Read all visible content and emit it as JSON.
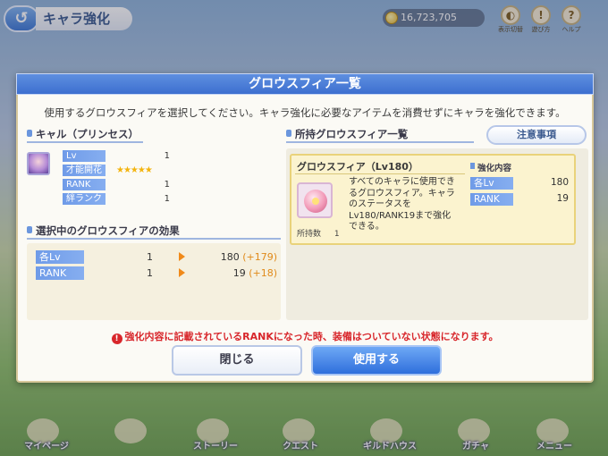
{
  "top": {
    "back_glyph": "↺",
    "screen_title": "キャラ強化",
    "money": "16,723,705",
    "icons": [
      {
        "name": "display-toggle-icon",
        "glyph": "◐",
        "label": "表示切替"
      },
      {
        "name": "guide-icon",
        "glyph": "!",
        "label": "遊び方"
      },
      {
        "name": "help-icon",
        "glyph": "?",
        "label": "ヘルプ"
      }
    ]
  },
  "dialog": {
    "title": "グロウスフィア一覧",
    "description": "使用するグロウスフィアを選択してください。キャラ強化に必要なアイテムを消費せずにキャラを強化できます。",
    "character": {
      "name": "キャル（プリンセス）",
      "stats": [
        {
          "label": "Lv",
          "value": "1"
        },
        {
          "label": "才能開花",
          "value": "★★★★★"
        },
        {
          "label": "RANK",
          "value": "1"
        },
        {
          "label": "絆ランク",
          "value": "1"
        }
      ]
    },
    "effect_section": {
      "title": "選択中のグロウスフィアの効果",
      "rows": [
        {
          "label": "各Lv",
          "from": "1",
          "to": "180",
          "plus": "(+179)"
        },
        {
          "label": "RANK",
          "from": "1",
          "to": "19",
          "plus": "(+18)"
        }
      ]
    },
    "owned_section": {
      "title": "所持グロウスフィア一覧",
      "notes_button": "注意事項",
      "item": {
        "name": "グロウスフィア（Lv180）",
        "description": "すべてのキャラに使用できるグロウスフィア。キャラのステータスをLv180/RANK19まで強化できる。",
        "owned_label": "所持数",
        "owned_count": "1",
        "effect_title": "強化内容",
        "effects": [
          {
            "label": "各Lv",
            "value": "180"
          },
          {
            "label": "RANK",
            "value": "19"
          }
        ]
      }
    },
    "warning": "強化内容に記載されているRANKになった時、装備はついていない状態になります。",
    "close_button": "閉じる",
    "use_button": "使用する"
  },
  "bottom_nav": [
    {
      "name": "nav-mypage",
      "label": "マイページ"
    },
    {
      "name": "nav-story",
      "label": "ストーリー"
    },
    {
      "name": "nav-quest",
      "label": "クエスト"
    },
    {
      "name": "nav-guildhouse",
      "label": "ギルドハウス"
    },
    {
      "name": "nav-gacha",
      "label": "ガチャ"
    },
    {
      "name": "nav-menu",
      "label": "メニュー"
    }
  ],
  "colors": {
    "accent": "#3d6fcf",
    "warning": "#d8262b",
    "plus": "#e08a1a",
    "star": "#f3b40f"
  }
}
